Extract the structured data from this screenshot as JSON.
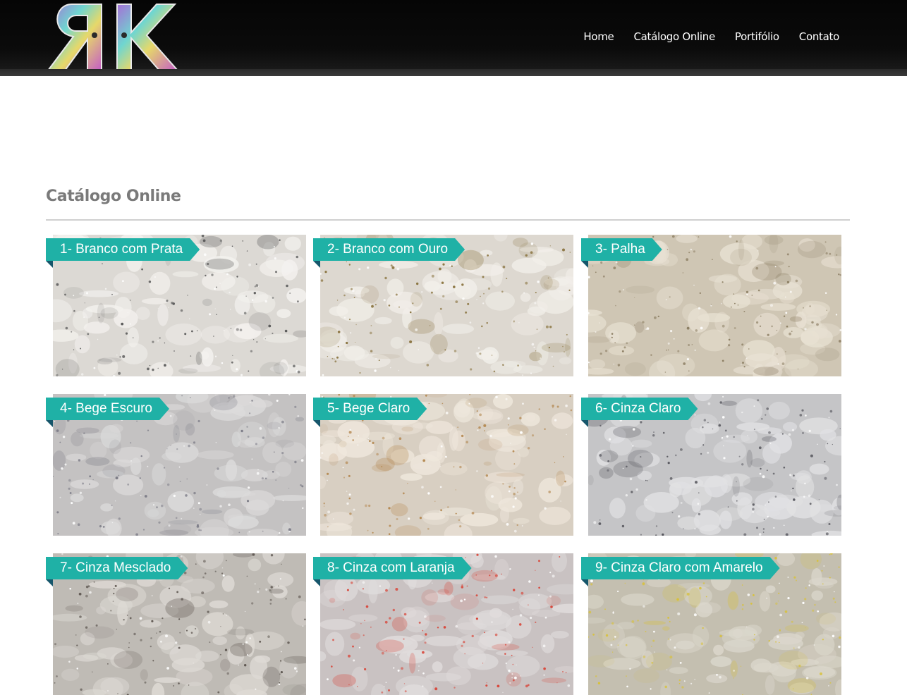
{
  "header": {
    "logo_text": "RK",
    "nav": [
      "Home",
      "Catálogo Online",
      "Portifólio",
      "Contato"
    ]
  },
  "main": {
    "title": "Catálogo Online"
  },
  "catalog": {
    "items": [
      {
        "label": "1- Branco com Prata",
        "base": "#dcd9d4",
        "accent": "#f4f2ef",
        "speck": "#5a5a5a"
      },
      {
        "label": "2- Branco com Ouro",
        "base": "#ddd8d0",
        "accent": "#f2efea",
        "speck": "#8a7440"
      },
      {
        "label": "3- Palha",
        "base": "#cfc6b4",
        "accent": "#e8e1d3",
        "speck": "#8b7d62"
      },
      {
        "label": "4- Bege Escuro",
        "base": "#c4c2c2",
        "accent": "#dcdbdb",
        "speck": "#7b7b86"
      },
      {
        "label": "5- Bege Claro",
        "base": "#d8cfc2",
        "accent": "#efe7dc",
        "speck": "#b58a54"
      },
      {
        "label": "6- Cinza Claro",
        "base": "#c5c5c7",
        "accent": "#e1e1e3",
        "speck": "#55555c"
      },
      {
        "label": "7- Cinza Mesclado",
        "base": "#bfbbb5",
        "accent": "#dedad5",
        "speck": "#5d5650"
      },
      {
        "label": "8- Cinza com Laranja",
        "base": "#c9c2c2",
        "accent": "#e0dcdc",
        "speck": "#d8483c"
      },
      {
        "label": "9- Cinza Claro com Amarelo",
        "base": "#c4bfb0",
        "accent": "#dbd7cc",
        "speck": "#d8c138"
      }
    ]
  }
}
